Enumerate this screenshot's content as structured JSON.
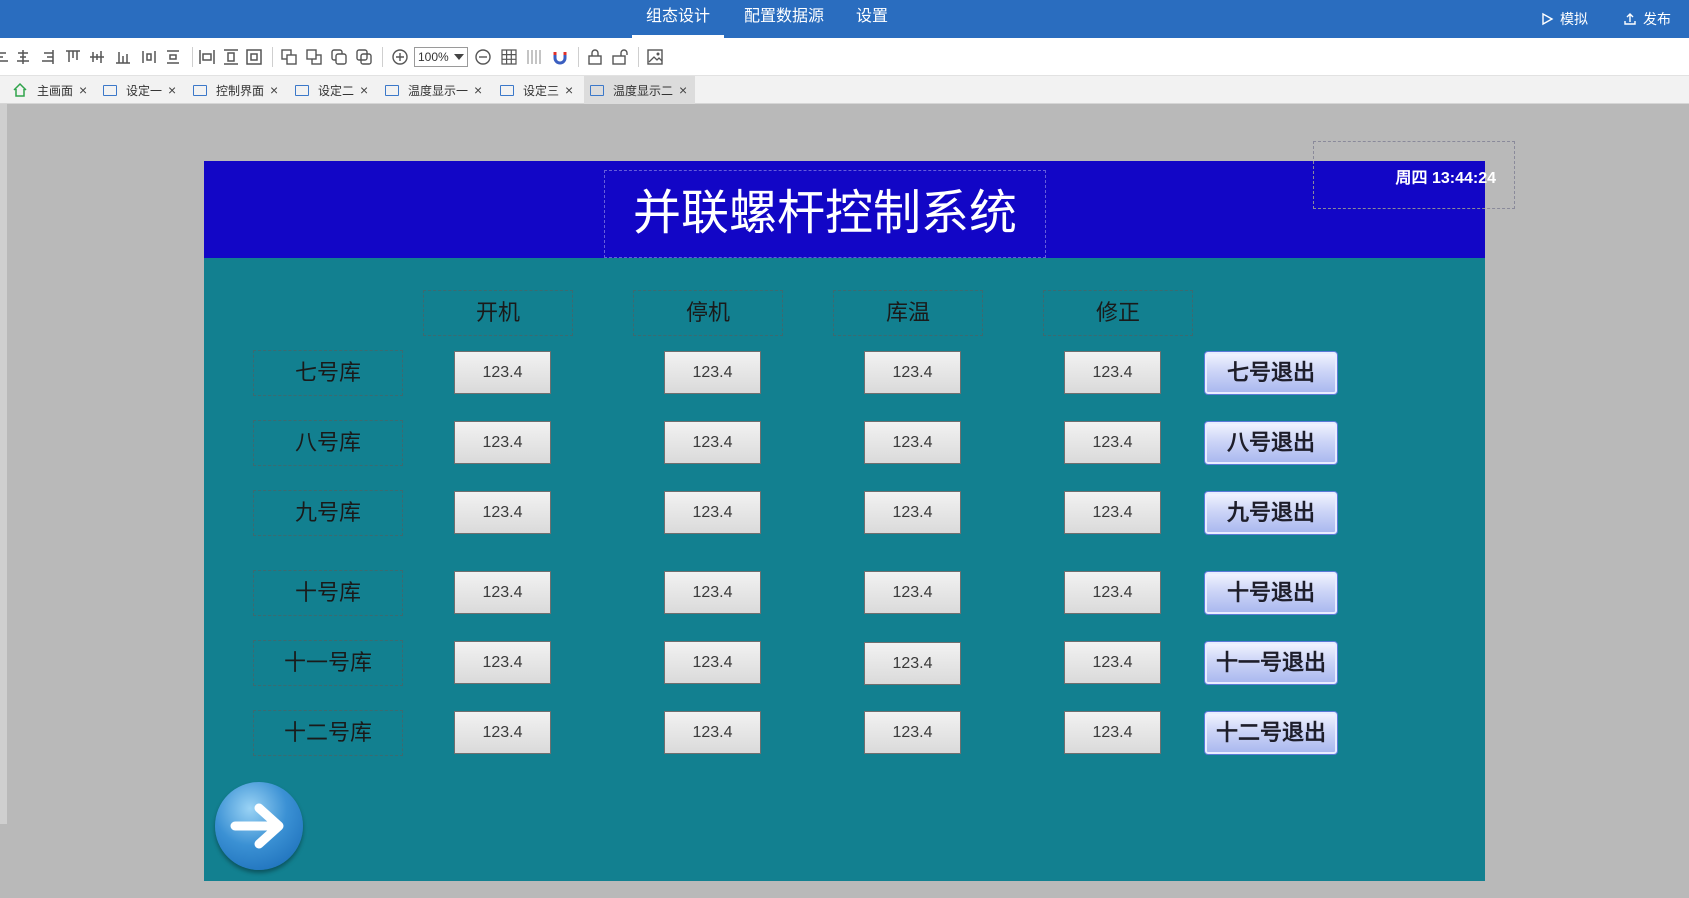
{
  "topbar": {
    "menu": [
      "组态设计",
      "配置数据源",
      "设置"
    ],
    "actions": {
      "simulate": "模拟",
      "publish": "发布"
    }
  },
  "toolbar": {
    "zoom": "100%",
    "icons": [
      "align-left-icon",
      "align-center-icon",
      "align-right-icon",
      "align-top-icon",
      "align-middle-icon",
      "align-bottom-icon",
      "distribute-h-icon",
      "distribute-v-icon",
      "same-width-icon",
      "same-height-icon",
      "same-size-icon",
      "bring-front-icon",
      "send-back-icon",
      "group-icon",
      "ungroup-icon",
      "zoom-in-icon",
      "zoom-out-icon",
      "grid-icon",
      "ruler-icon",
      "magnet-icon",
      "lock-icon",
      "unlock-icon",
      "image-icon"
    ]
  },
  "tabs": [
    {
      "label": "主画面",
      "home": true
    },
    {
      "label": "设定一"
    },
    {
      "label": "控制界面"
    },
    {
      "label": "设定二"
    },
    {
      "label": "温度显示一"
    },
    {
      "label": "设定三"
    },
    {
      "label": "温度显示二",
      "active": true
    }
  ],
  "screen": {
    "title": "并联螺杆控制系统",
    "clock": "周四 13:44:24",
    "columns": [
      "开机",
      "停机",
      "库温",
      "修正"
    ],
    "rows": [
      {
        "label": "七号库",
        "values": [
          "123.4",
          "123.4",
          "123.4",
          "123.4"
        ],
        "exit": "七号退出"
      },
      {
        "label": "八号库",
        "values": [
          "123.4",
          "123.4",
          "123.4",
          "123.4"
        ],
        "exit": "八号退出"
      },
      {
        "label": "九号库",
        "values": [
          "123.4",
          "123.4",
          "123.4",
          "123.4"
        ],
        "exit": "九号退出"
      },
      {
        "label": "十号库",
        "values": [
          "123.4",
          "123.4",
          "123.4",
          "123.4"
        ],
        "exit": "十号退出"
      },
      {
        "label": "十一号库",
        "values": [
          "123.4",
          "123.4",
          "123.4",
          "123.4"
        ],
        "exit": "十一号退出"
      },
      {
        "label": "十二号库",
        "values": [
          "123.4",
          "123.4",
          "123.4",
          "123.4"
        ],
        "exit": "十二号退出"
      }
    ],
    "colors": {
      "canvas": "#128090",
      "header": "#1206c6",
      "topbar": "#2a6dbf"
    }
  }
}
